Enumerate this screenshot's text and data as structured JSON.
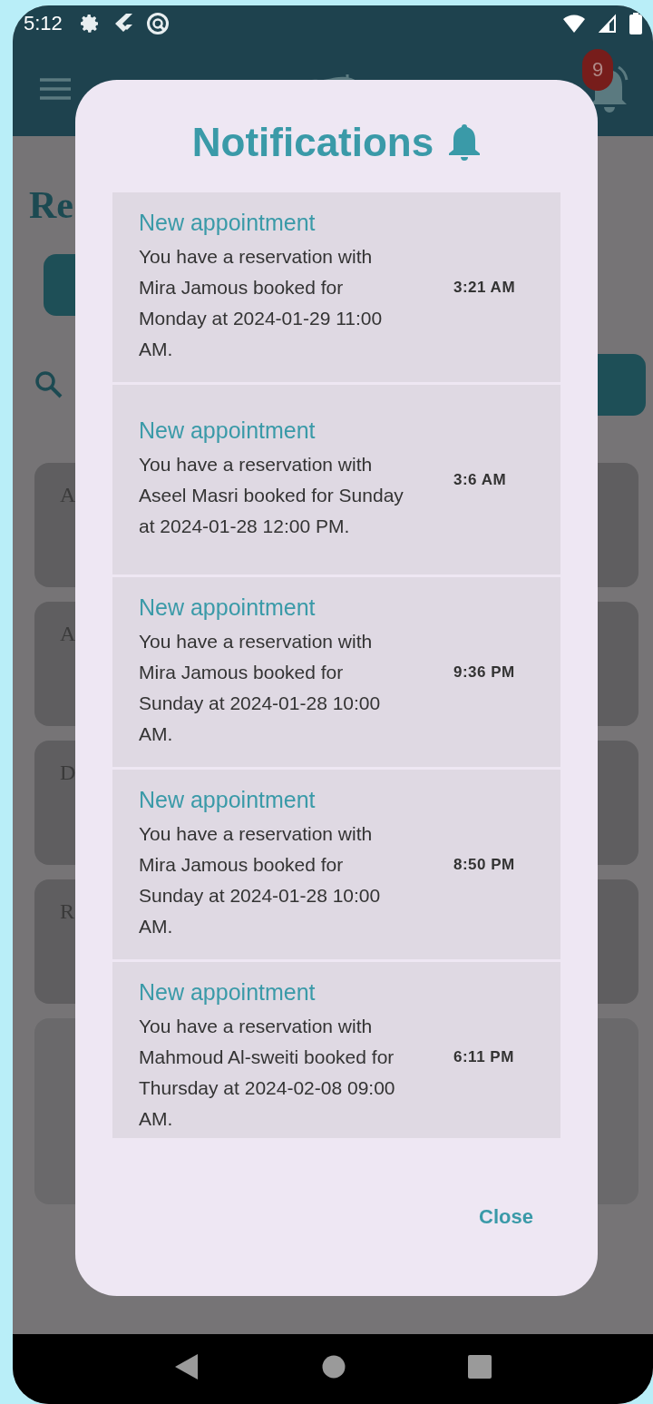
{
  "status_bar": {
    "time": "5:12"
  },
  "app_bar": {
    "badge": "9"
  },
  "page": {
    "heading": "Re",
    "cards": [
      {
        "text": "A"
      },
      {
        "text": "A"
      },
      {
        "text": "D"
      },
      {
        "text": "R"
      },
      {
        "kind": "large"
      }
    ]
  },
  "dialog": {
    "title": "Notifications",
    "items": [
      {
        "title": "New appointment",
        "body": "You have a reservation with Mira Jamous booked for Monday at 2024-01-29 11:00 AM.",
        "time": "3:21 AM"
      },
      {
        "title": "New appointment",
        "body": "You have a reservation with Aseel Masri booked for Sunday at 2024-01-28 12:00 PM.",
        "time": "3:6 AM"
      },
      {
        "title": "New appointment",
        "body": "You have a reservation with Mira Jamous booked for Sunday at 2024-01-28 10:00 AM.",
        "time": "9:36 PM"
      },
      {
        "title": "New appointment",
        "body": "You have a reservation with Mira Jamous booked for Sunday at 2024-01-28 10:00 AM.",
        "time": "8:50 PM"
      },
      {
        "title": "New appointment",
        "body": "You have a reservation with Mahmoud Al-sweiti booked for Thursday at 2024-02-08 09:00 AM.",
        "time": "6:11 PM"
      }
    ],
    "close": "Close"
  }
}
